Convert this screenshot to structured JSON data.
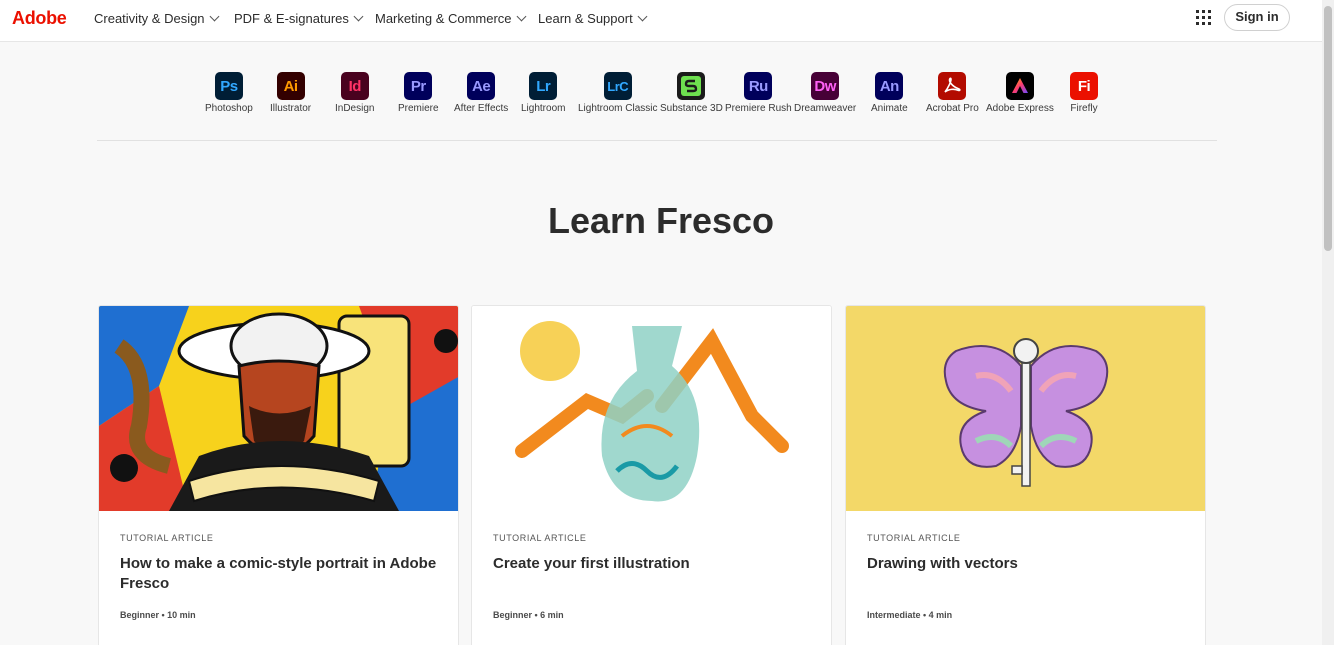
{
  "header": {
    "logo": "Adobe",
    "nav": [
      {
        "label": "Creativity & Design"
      },
      {
        "label": "PDF & E-signatures"
      },
      {
        "label": "Marketing & Commerce"
      },
      {
        "label": "Learn & Support"
      }
    ],
    "signin_label": "Sign in"
  },
  "products": [
    {
      "abbr": "Ps",
      "label": "Photoshop",
      "bg": "#001e36",
      "fg": "#31a8ff"
    },
    {
      "abbr": "Ai",
      "label": "Illustrator",
      "bg": "#330000",
      "fg": "#ff9a00"
    },
    {
      "abbr": "Id",
      "label": "InDesign",
      "bg": "#49021f",
      "fg": "#ff3366"
    },
    {
      "abbr": "Pr",
      "label": "Premiere",
      "bg": "#00005b",
      "fg": "#9999ff"
    },
    {
      "abbr": "Ae",
      "label": "After Effects",
      "bg": "#00005b",
      "fg": "#9999ff"
    },
    {
      "abbr": "Lr",
      "label": "Lightroom",
      "bg": "#001e36",
      "fg": "#31a8ff"
    },
    {
      "abbr": "LrC",
      "label": "Lightroom Classic",
      "bg": "#001e36",
      "fg": "#31a8ff"
    },
    {
      "abbr": "S",
      "label": "Substance 3D",
      "bg": "#1b1b1b",
      "fg": "#6ee04f"
    },
    {
      "abbr": "Ru",
      "label": "Premiere Rush",
      "bg": "#00005b",
      "fg": "#9999ff"
    },
    {
      "abbr": "Dw",
      "label": "Dreamweaver",
      "bg": "#470137",
      "fg": "#ff61f6"
    },
    {
      "abbr": "An",
      "label": "Animate",
      "bg": "#00005b",
      "fg": "#9999ff"
    },
    {
      "abbr": "",
      "label": "Acrobat Pro",
      "bg": "#b30b00",
      "fg": "#ffffff"
    },
    {
      "abbr": "",
      "label": "Adobe Express",
      "bg": "#000000",
      "fg": "#ff4f8a"
    },
    {
      "abbr": "Fi",
      "label": "Firefly",
      "bg": "#eb1000",
      "fg": "#ffffff"
    }
  ],
  "page_title": "Learn Fresco",
  "cards": [
    {
      "type": "TUTORIAL ARTICLE",
      "title": "How to make a comic-style portrait in Adobe Fresco",
      "meta": "Beginner • 10 min"
    },
    {
      "type": "TUTORIAL ARTICLE",
      "title": "Create your first illustration",
      "meta": "Beginner • 6 min"
    },
    {
      "type": "TUTORIAL ARTICLE",
      "title": "Drawing with vectors",
      "meta": "Intermediate • 4 min"
    }
  ]
}
